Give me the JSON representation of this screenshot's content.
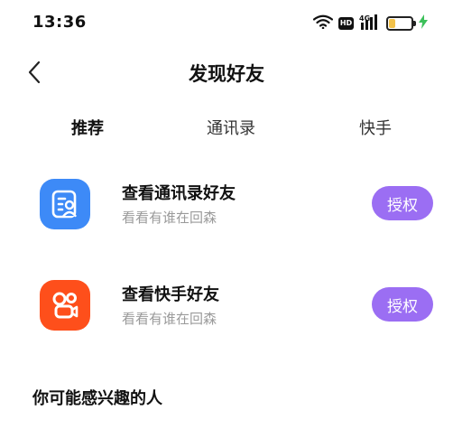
{
  "status_bar": {
    "time": "13:36",
    "hd_label": "HD",
    "network_label": "4G",
    "battery_level": 0.3,
    "icons": [
      "wifi-icon",
      "hd-icon",
      "signal-icon",
      "battery-icon",
      "charging-icon"
    ]
  },
  "header": {
    "title": "发现好友",
    "back_icon": "chevron-left-icon"
  },
  "tabs": [
    {
      "label": "推荐",
      "active": true
    },
    {
      "label": "通讯录",
      "active": false
    },
    {
      "label": "快手",
      "active": false
    }
  ],
  "friend_sources": [
    {
      "title": "查看通讯录好友",
      "subtitle": "看看有谁在回森",
      "button_label": "授权",
      "icon": "contacts-icon",
      "icon_color": "#3d8af7"
    },
    {
      "title": "查看快手好友",
      "subtitle": "看看有谁在回森",
      "button_label": "授权",
      "icon": "kuaishou-icon",
      "icon_color": "#fe4f1b"
    }
  ],
  "section": {
    "title": "你可能感兴趣的人"
  },
  "colors": {
    "accent": "#9b6ef3",
    "tab_underline": "#f6c343",
    "subtitle": "#9a9a9a"
  }
}
